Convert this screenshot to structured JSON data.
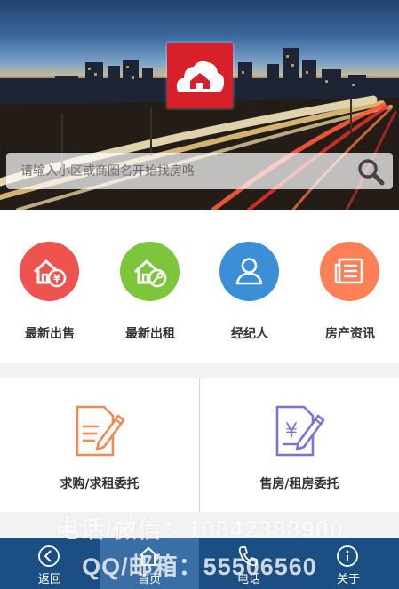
{
  "search": {
    "placeholder": "请输入小区或商圈名开始找房咯"
  },
  "categories": [
    {
      "label": "最新出售",
      "icon": "house-sale-icon",
      "color": "#ef5350"
    },
    {
      "label": "最新出租",
      "icon": "house-rent-icon",
      "color": "#7cc63b"
    },
    {
      "label": "经纪人",
      "icon": "agent-icon",
      "color": "#3b8fd6"
    },
    {
      "label": "房产资讯",
      "icon": "news-icon",
      "color": "#ff7f57"
    }
  ],
  "panels": [
    {
      "label": "求购/求租委托",
      "icon": "request-document-icon",
      "color": "#f08a50"
    },
    {
      "label": "售房/租房委托",
      "icon": "listing-document-icon",
      "color": "#7b73d2"
    }
  ],
  "watermark": {
    "line1": "电话/微信：18842388900",
    "line2": "QQ/邮箱：55506560"
  },
  "tabs": [
    {
      "label": "返回",
      "icon": "back-icon"
    },
    {
      "label": "首页",
      "icon": "home-icon"
    },
    {
      "label": "电话",
      "icon": "phone-icon"
    },
    {
      "label": "关于",
      "icon": "info-icon"
    }
  ],
  "colors": {
    "brand": "#d8202a",
    "tabbar": "#1b4f83",
    "tab_active": "#3a6fa6"
  }
}
